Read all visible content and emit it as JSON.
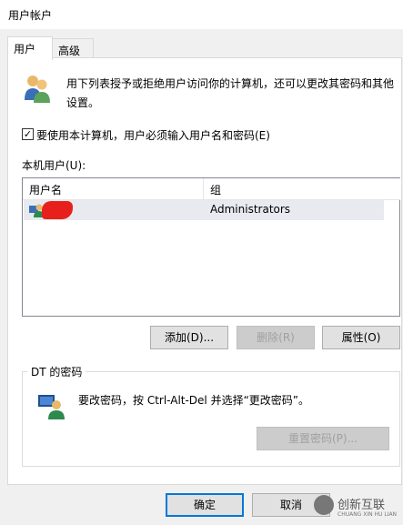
{
  "window": {
    "title": "用户帐户"
  },
  "tabs": [
    {
      "label": "用户"
    },
    {
      "label": "高级"
    }
  ],
  "intro_text_line1": "用下列表授予或拒绝用户访问你的计算机，还可以更改其密码和其他",
  "intro_text_line2": "设置。",
  "require_login_checkbox": {
    "label": "要使用本计算机，用户必须输入用户名和密码(E)",
    "checked": true
  },
  "users_list": {
    "label": "本机用户(U):",
    "columns": [
      "用户名",
      "组"
    ],
    "rows": [
      {
        "username": "",
        "group": "Administrators"
      }
    ]
  },
  "user_buttons": {
    "add": "添加(D)...",
    "remove": "删除(R)",
    "properties": "属性(O)"
  },
  "password_group": {
    "title": "DT 的密码",
    "text": "要改密码，按 Ctrl-Alt-Del 并选择“更改密码”。",
    "reset_button": "重置密码(P)..."
  },
  "dialog_buttons": {
    "ok": "确定",
    "cancel": "取消"
  },
  "watermark": {
    "text": "创新互联",
    "subtext": "CHUANG XIN HU LIAN"
  },
  "colors": {
    "accent": "#0078d7",
    "window_bg": "#f0f0f0",
    "panel_bg": "#ffffff",
    "selected_row": "#e8eaf0"
  }
}
